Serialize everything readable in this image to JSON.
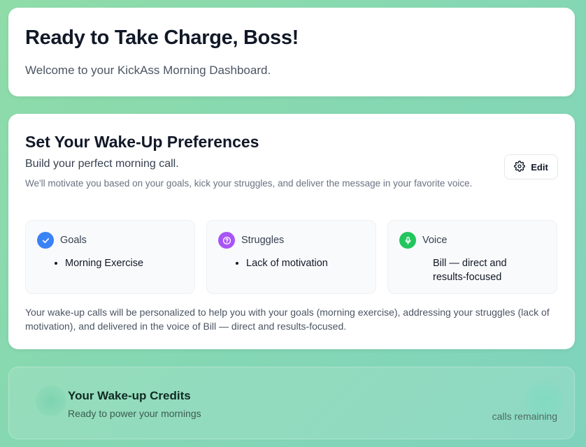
{
  "hero": {
    "title": "Ready to Take Charge, Boss!",
    "subtitle": "Welcome to your KickAss Morning Dashboard."
  },
  "preferences": {
    "title": "Set Your Wake-Up Preferences",
    "subtitle": "Build your perfect morning call.",
    "description": "We'll motivate you based on your goals, kick your struggles, and deliver the message in your favorite voice.",
    "edit_label": "Edit",
    "goals": {
      "label": "Goals",
      "icon": "check-icon",
      "color": "#3b82f6",
      "items": [
        "Morning Exercise"
      ]
    },
    "struggles": {
      "label": "Struggles",
      "icon": "question-icon",
      "color": "#a855f7",
      "items": [
        "Lack of motivation"
      ]
    },
    "voice": {
      "label": "Voice",
      "icon": "microphone-icon",
      "color": "#22c55e",
      "value": "Bill — direct and results-focused"
    },
    "summary": "Your wake-up calls will be personalized to help you with your goals (morning exercise), addressing your struggles (lack of motivation), and delivered in the voice of Bill — direct and results-focused."
  },
  "credits": {
    "title": "Your Wake-up Credits",
    "tagline": "Ready to power your mornings",
    "remaining_label": "calls remaining"
  }
}
